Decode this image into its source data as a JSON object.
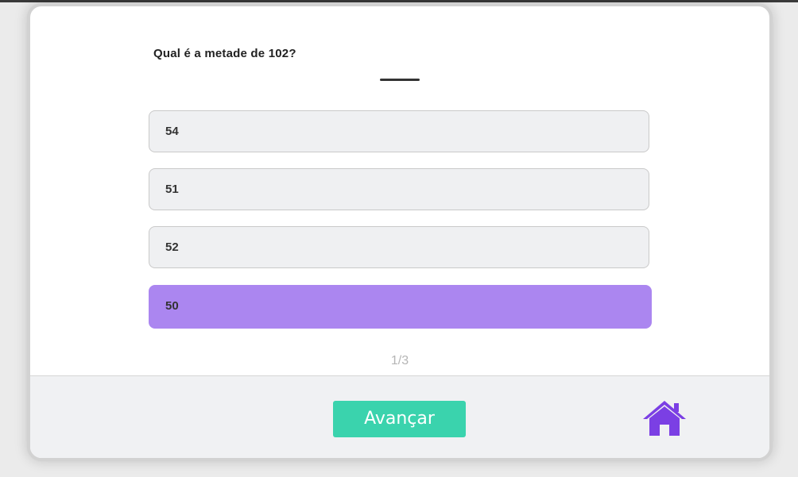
{
  "quiz": {
    "question": "Qual é a metade de 102?",
    "options": [
      {
        "label": "54",
        "selected": false
      },
      {
        "label": "51",
        "selected": false
      },
      {
        "label": "52",
        "selected": false
      },
      {
        "label": "50",
        "selected": true
      }
    ],
    "progress": "1/3"
  },
  "footer": {
    "next_label": "Avançar",
    "home_icon": "home-icon"
  },
  "colors": {
    "selected_option": "#ab86f0",
    "next_button": "#3ad3ad",
    "home_icon": "#7b3fe4"
  }
}
